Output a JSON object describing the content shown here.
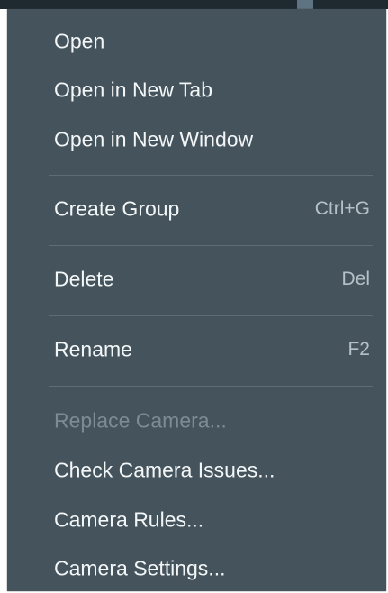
{
  "menu": {
    "items": [
      {
        "label": "Open",
        "shortcut": ""
      },
      {
        "label": "Open in New Tab",
        "shortcut": ""
      },
      {
        "label": "Open in New Window",
        "shortcut": ""
      },
      {
        "label": "Create Group",
        "shortcut": "Ctrl+G"
      },
      {
        "label": "Delete",
        "shortcut": "Del"
      },
      {
        "label": "Rename",
        "shortcut": "F2"
      },
      {
        "label": "Replace Camera...",
        "shortcut": ""
      },
      {
        "label": "Check Camera Issues...",
        "shortcut": ""
      },
      {
        "label": "Camera Rules...",
        "shortcut": ""
      },
      {
        "label": "Camera Settings...",
        "shortcut": ""
      }
    ],
    "disabled_item_index": 6,
    "highlighted_item_index": 8,
    "colors": {
      "background": "#44535c",
      "text": "#f3f6f7",
      "shortcut_text": "#b6c1c7",
      "disabled_text": "#7d8c94",
      "highlight": "#c8e200"
    }
  }
}
